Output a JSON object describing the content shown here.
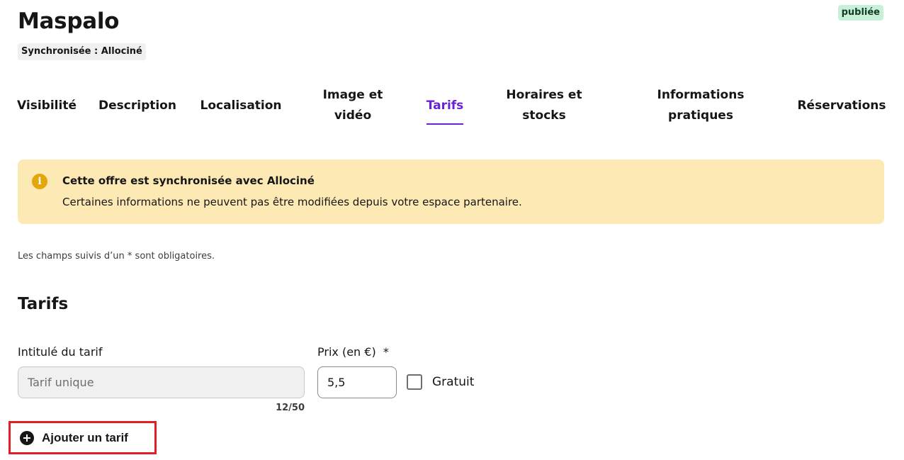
{
  "header": {
    "title": "Maspalo",
    "status_badge": "publiée",
    "sync_badge": "Synchronisée : Allociné"
  },
  "tabs": [
    {
      "label": "Visibilité",
      "active": false
    },
    {
      "label": "Description",
      "active": false
    },
    {
      "label": "Localisation",
      "active": false
    },
    {
      "label": "Image et vidéo",
      "active": false
    },
    {
      "label": "Tarifs",
      "active": true
    },
    {
      "label": "Horaires et stocks",
      "active": false
    },
    {
      "label": "Informations pratiques",
      "active": false
    },
    {
      "label": "Réservations",
      "active": false
    }
  ],
  "callout": {
    "icon": "info-icon",
    "title": "Cette offre est synchronisée avec Allociné",
    "text": "Certaines informations ne peuvent pas être modifiées depuis votre espace partenaire."
  },
  "required_hint": "Les champs suivis d’un * sont obligatoires.",
  "section": {
    "title": "Tarifs"
  },
  "form": {
    "intitule_label": "Intitulé du tarif",
    "intitule_value": "Tarif unique",
    "intitule_counter": "12/50",
    "prix_label": "Prix (en €)  *",
    "prix_value": "5,5",
    "gratuit_label": "Gratuit",
    "gratuit_checked": false
  },
  "actions": {
    "add_tarif_label": "Ajouter un tarif"
  },
  "colors": {
    "accent": "#6923d4",
    "callout_bg": "#fde9b3",
    "info_icon": "#e3a70c",
    "status_badge_bg": "#c8f0d8",
    "highlight_border": "#e01f26"
  }
}
